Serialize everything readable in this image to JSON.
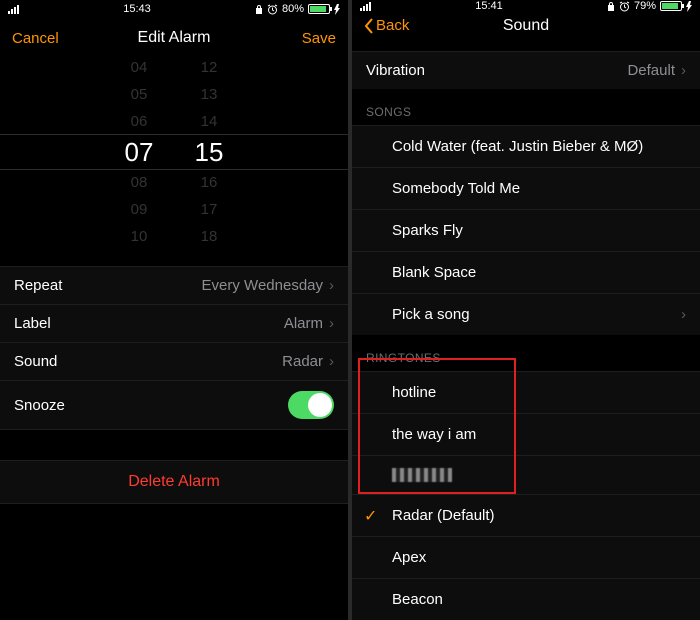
{
  "left": {
    "status": {
      "time": "15:43",
      "battery": "80%"
    },
    "nav": {
      "cancel": "Cancel",
      "title": "Edit Alarm",
      "save": "Save"
    },
    "picker": {
      "hours": [
        "04",
        "05",
        "06",
        "07",
        "08",
        "09",
        "10"
      ],
      "mins": [
        "12",
        "13",
        "14",
        "15",
        "16",
        "17",
        "18"
      ]
    },
    "rows": {
      "repeat": {
        "label": "Repeat",
        "value": "Every Wednesday"
      },
      "label": {
        "label": "Label",
        "value": "Alarm"
      },
      "sound": {
        "label": "Sound",
        "value": "Radar"
      },
      "snooze": {
        "label": "Snooze"
      }
    },
    "delete": "Delete Alarm"
  },
  "right": {
    "status": {
      "time": "15:41",
      "battery": "79%"
    },
    "nav": {
      "back": "Back",
      "title": "Sound"
    },
    "vibration": {
      "label": "Vibration",
      "value": "Default"
    },
    "songs_header": "SONGS",
    "songs": [
      "Cold Water (feat. Justin Bieber & MØ)",
      "Somebody Told Me",
      "Sparks Fly",
      "Blank Space",
      "Pick a song"
    ],
    "ringtones_header": "RINGTONES",
    "custom_ringtones": [
      "hotline",
      "the way i am"
    ],
    "ringtones": [
      "Radar (Default)",
      "Apex",
      "Beacon"
    ]
  }
}
